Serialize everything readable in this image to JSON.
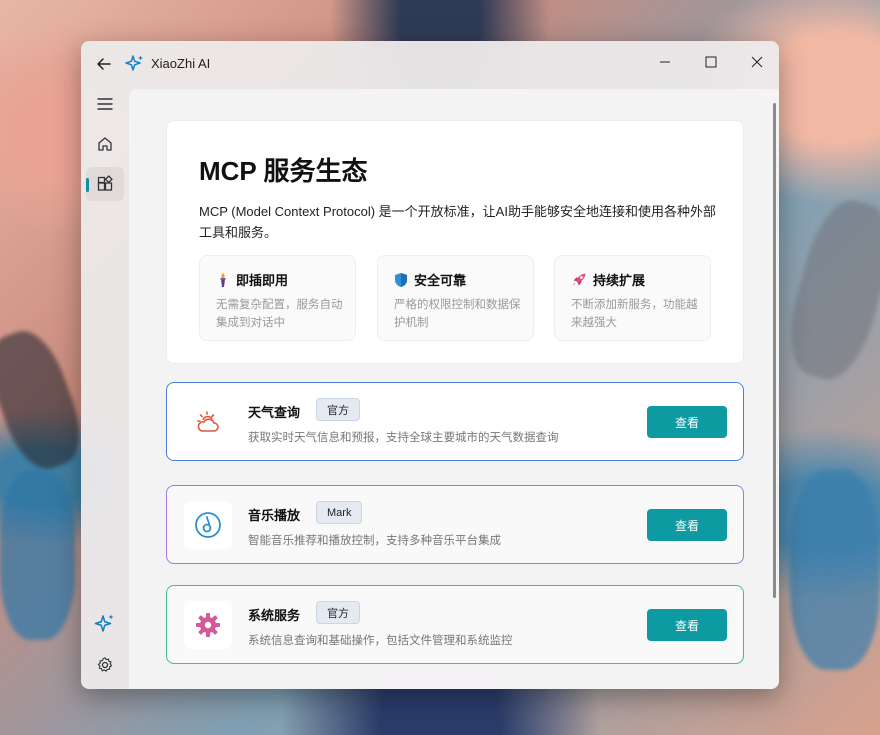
{
  "window": {
    "title": "XiaoZhi AI"
  },
  "intro": {
    "title": "MCP 服务生态",
    "description": "MCP (Model Context Protocol) 是一个开放标准，让AI助手能够安全地连接和使用各种外部工具和服务。",
    "features": [
      {
        "icon": "torch-icon",
        "title": "即插即用",
        "desc": "无需复杂配置，服务自动集成到对话中"
      },
      {
        "icon": "shield-icon",
        "title": "安全可靠",
        "desc": "严格的权限控制和数据保护机制"
      },
      {
        "icon": "rocket-icon",
        "title": "持续扩展",
        "desc": "不断添加新服务，功能越来越强大"
      }
    ]
  },
  "services": [
    {
      "name": "天气查询",
      "badge": "官方",
      "desc": "获取实时天气信息和预报，支持全球主要城市的天气数据查询",
      "button": "查看",
      "icon": "weather-icon",
      "border_color": "#4a7fe0"
    },
    {
      "name": "音乐播放",
      "badge": "Mark",
      "desc": "智能音乐推荐和播放控制，支持多种音乐平台集成",
      "button": "查看",
      "icon": "music-icon",
      "border_color": "#9b78e6"
    },
    {
      "name": "系统服务",
      "badge": "官方",
      "desc": "系统信息查询和基础操作，包括文件管理和系统监控",
      "button": "查看",
      "icon": "gear-service-icon",
      "border_color": "#3fbf8e"
    }
  ],
  "colors": {
    "accent": "#0e9aa1"
  }
}
